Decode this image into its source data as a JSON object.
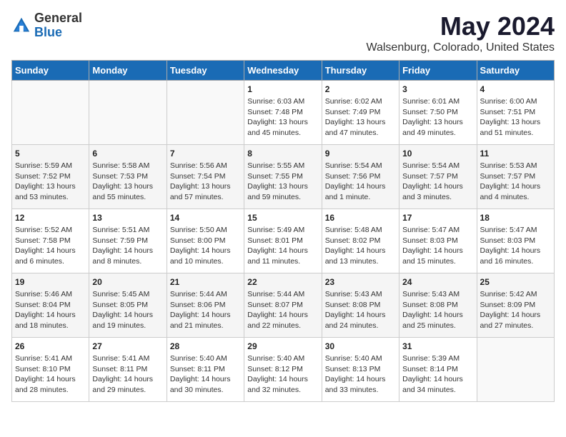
{
  "logo": {
    "general": "General",
    "blue": "Blue"
  },
  "header": {
    "title": "May 2024",
    "subtitle": "Walsenburg, Colorado, United States"
  },
  "days_of_week": [
    "Sunday",
    "Monday",
    "Tuesday",
    "Wednesday",
    "Thursday",
    "Friday",
    "Saturday"
  ],
  "weeks": [
    [
      {
        "num": "",
        "info": ""
      },
      {
        "num": "",
        "info": ""
      },
      {
        "num": "",
        "info": ""
      },
      {
        "num": "1",
        "info": "Sunrise: 6:03 AM\nSunset: 7:48 PM\nDaylight: 13 hours\nand 45 minutes."
      },
      {
        "num": "2",
        "info": "Sunrise: 6:02 AM\nSunset: 7:49 PM\nDaylight: 13 hours\nand 47 minutes."
      },
      {
        "num": "3",
        "info": "Sunrise: 6:01 AM\nSunset: 7:50 PM\nDaylight: 13 hours\nand 49 minutes."
      },
      {
        "num": "4",
        "info": "Sunrise: 6:00 AM\nSunset: 7:51 PM\nDaylight: 13 hours\nand 51 minutes."
      }
    ],
    [
      {
        "num": "5",
        "info": "Sunrise: 5:59 AM\nSunset: 7:52 PM\nDaylight: 13 hours\nand 53 minutes."
      },
      {
        "num": "6",
        "info": "Sunrise: 5:58 AM\nSunset: 7:53 PM\nDaylight: 13 hours\nand 55 minutes."
      },
      {
        "num": "7",
        "info": "Sunrise: 5:56 AM\nSunset: 7:54 PM\nDaylight: 13 hours\nand 57 minutes."
      },
      {
        "num": "8",
        "info": "Sunrise: 5:55 AM\nSunset: 7:55 PM\nDaylight: 13 hours\nand 59 minutes."
      },
      {
        "num": "9",
        "info": "Sunrise: 5:54 AM\nSunset: 7:56 PM\nDaylight: 14 hours\nand 1 minute."
      },
      {
        "num": "10",
        "info": "Sunrise: 5:54 AM\nSunset: 7:57 PM\nDaylight: 14 hours\nand 3 minutes."
      },
      {
        "num": "11",
        "info": "Sunrise: 5:53 AM\nSunset: 7:57 PM\nDaylight: 14 hours\nand 4 minutes."
      }
    ],
    [
      {
        "num": "12",
        "info": "Sunrise: 5:52 AM\nSunset: 7:58 PM\nDaylight: 14 hours\nand 6 minutes."
      },
      {
        "num": "13",
        "info": "Sunrise: 5:51 AM\nSunset: 7:59 PM\nDaylight: 14 hours\nand 8 minutes."
      },
      {
        "num": "14",
        "info": "Sunrise: 5:50 AM\nSunset: 8:00 PM\nDaylight: 14 hours\nand 10 minutes."
      },
      {
        "num": "15",
        "info": "Sunrise: 5:49 AM\nSunset: 8:01 PM\nDaylight: 14 hours\nand 11 minutes."
      },
      {
        "num": "16",
        "info": "Sunrise: 5:48 AM\nSunset: 8:02 PM\nDaylight: 14 hours\nand 13 minutes."
      },
      {
        "num": "17",
        "info": "Sunrise: 5:47 AM\nSunset: 8:03 PM\nDaylight: 14 hours\nand 15 minutes."
      },
      {
        "num": "18",
        "info": "Sunrise: 5:47 AM\nSunset: 8:03 PM\nDaylight: 14 hours\nand 16 minutes."
      }
    ],
    [
      {
        "num": "19",
        "info": "Sunrise: 5:46 AM\nSunset: 8:04 PM\nDaylight: 14 hours\nand 18 minutes."
      },
      {
        "num": "20",
        "info": "Sunrise: 5:45 AM\nSunset: 8:05 PM\nDaylight: 14 hours\nand 19 minutes."
      },
      {
        "num": "21",
        "info": "Sunrise: 5:44 AM\nSunset: 8:06 PM\nDaylight: 14 hours\nand 21 minutes."
      },
      {
        "num": "22",
        "info": "Sunrise: 5:44 AM\nSunset: 8:07 PM\nDaylight: 14 hours\nand 22 minutes."
      },
      {
        "num": "23",
        "info": "Sunrise: 5:43 AM\nSunset: 8:08 PM\nDaylight: 14 hours\nand 24 minutes."
      },
      {
        "num": "24",
        "info": "Sunrise: 5:43 AM\nSunset: 8:08 PM\nDaylight: 14 hours\nand 25 minutes."
      },
      {
        "num": "25",
        "info": "Sunrise: 5:42 AM\nSunset: 8:09 PM\nDaylight: 14 hours\nand 27 minutes."
      }
    ],
    [
      {
        "num": "26",
        "info": "Sunrise: 5:41 AM\nSunset: 8:10 PM\nDaylight: 14 hours\nand 28 minutes."
      },
      {
        "num": "27",
        "info": "Sunrise: 5:41 AM\nSunset: 8:11 PM\nDaylight: 14 hours\nand 29 minutes."
      },
      {
        "num": "28",
        "info": "Sunrise: 5:40 AM\nSunset: 8:11 PM\nDaylight: 14 hours\nand 30 minutes."
      },
      {
        "num": "29",
        "info": "Sunrise: 5:40 AM\nSunset: 8:12 PM\nDaylight: 14 hours\nand 32 minutes."
      },
      {
        "num": "30",
        "info": "Sunrise: 5:40 AM\nSunset: 8:13 PM\nDaylight: 14 hours\nand 33 minutes."
      },
      {
        "num": "31",
        "info": "Sunrise: 5:39 AM\nSunset: 8:14 PM\nDaylight: 14 hours\nand 34 minutes."
      },
      {
        "num": "",
        "info": ""
      }
    ]
  ]
}
